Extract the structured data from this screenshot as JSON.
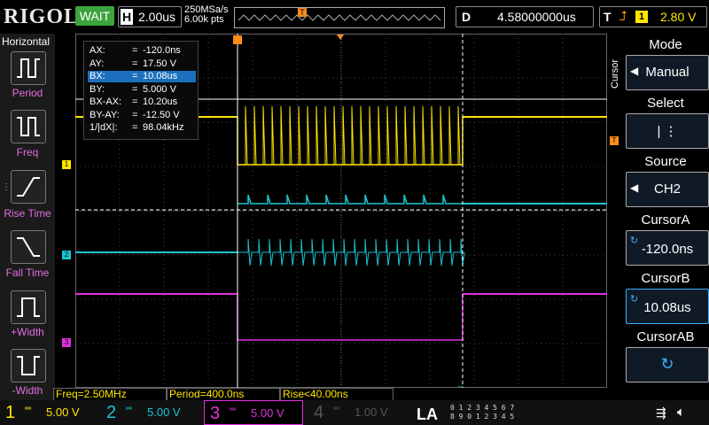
{
  "header": {
    "logo": "RIGOL",
    "run_state": "WAIT",
    "horizontal": {
      "key": "H",
      "value": "2.00us"
    },
    "sample_rate": "250MSa/s",
    "memory_depth": "6.00k pts",
    "trigger_marker": "T",
    "delay": {
      "key": "D",
      "value": "4.58000000us"
    },
    "trigger": {
      "key": "T",
      "channel": "1",
      "level": "2.80 V"
    }
  },
  "left_panel": {
    "title": "Horizontal",
    "items": [
      {
        "label": "Period",
        "icon": "period-icon"
      },
      {
        "label": "Freq",
        "icon": "freq-icon"
      },
      {
        "label": "Rise Time",
        "icon": "rise-time-icon"
      },
      {
        "label": "Fall Time",
        "icon": "fall-time-icon"
      },
      {
        "label": "+Width",
        "icon": "pos-width-icon"
      },
      {
        "label": "-Width",
        "icon": "neg-width-icon"
      }
    ]
  },
  "cursor_readout": {
    "rows": [
      {
        "name": "AX:",
        "value": "-120.0ns"
      },
      {
        "name": "AY:",
        "value": "17.50 V"
      },
      {
        "name": "BX:",
        "value": "10.08us"
      },
      {
        "name": "BY:",
        "value": "5.000 V"
      },
      {
        "name": "BX-AX:",
        "value": "10.20us"
      },
      {
        "name": "BY-AY:",
        "value": "-12.50 V"
      },
      {
        "name": "1/|dX|:",
        "value": "98.04kHz"
      }
    ],
    "selected_index": 2
  },
  "right_panel": {
    "side_label": "Cursor",
    "mode": {
      "title": "Mode",
      "value": "Manual"
    },
    "select": {
      "title": "Select",
      "value": "|   ⋮"
    },
    "source": {
      "title": "Source",
      "value": "CH2"
    },
    "cursor_a": {
      "title": "CursorA",
      "value": "-120.0ns"
    },
    "cursor_b": {
      "title": "CursorB",
      "value": "10.08us"
    },
    "cursor_ab": {
      "title": "CursorAB"
    }
  },
  "measurements": [
    {
      "label": "Freq=2.50MHz"
    },
    {
      "label": "Period=400.0ns"
    },
    {
      "label": "Rise<40.00ns"
    }
  ],
  "channels": [
    {
      "num": "1",
      "coupling": "═",
      "scale": "5.00 V",
      "color": "#ffe600"
    },
    {
      "num": "2",
      "coupling": "═",
      "scale": "5.00 V",
      "color": "#19c5d2"
    },
    {
      "num": "3",
      "coupling": "═",
      "scale": "5.00 V",
      "color": "#e030e0"
    },
    {
      "num": "4",
      "coupling": "═",
      "scale": "1.00 V",
      "color": "#555555"
    }
  ],
  "la": {
    "label": "LA",
    "digits_row1": "0 1 2 3   4 5 6 7",
    "digits_row2": "8 9 0 1   2 3 4 5"
  },
  "colors": {
    "ch1": "#ffe600",
    "ch2": "#19c5d2",
    "ch3": "#e030e0",
    "trigger": "#ff8c1a",
    "accent": "#1c6fbf"
  }
}
